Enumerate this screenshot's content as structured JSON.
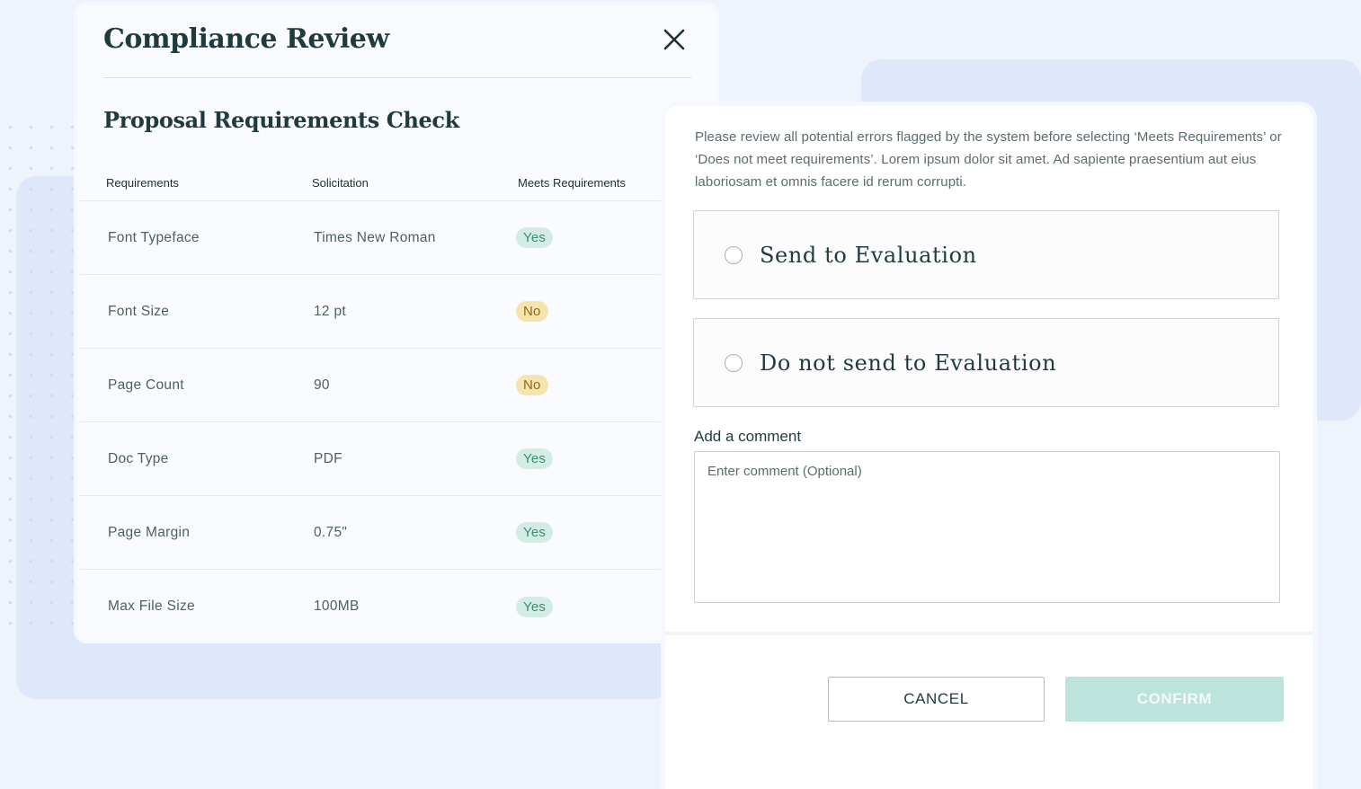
{
  "compliance": {
    "title": "Compliance Review",
    "subtitle": "Proposal Requirements Check",
    "headers": [
      "Requirements",
      "Solicitation",
      "Meets Requirements"
    ],
    "rows": [
      {
        "requirement": "Font Typeface",
        "solicitation": "Times New Roman",
        "meets": "Yes"
      },
      {
        "requirement": "Font Size",
        "solicitation": "12 pt",
        "meets": "No"
      },
      {
        "requirement": "Page Count",
        "solicitation": "90",
        "meets": "No"
      },
      {
        "requirement": "Doc Type",
        "solicitation": "PDF",
        "meets": "Yes"
      },
      {
        "requirement": "Page Margin",
        "solicitation": "0.75\"",
        "meets": "Yes"
      },
      {
        "requirement": "Max File Size",
        "solicitation": "100MB",
        "meets": "Yes"
      }
    ]
  },
  "decision": {
    "instructions": "Please review all potential errors flagged by the system before selecting ‘Meets Requirements’ or ‘Does not meet requirements’. Lorem ipsum dolor sit amet. Ad sapiente praesentium aut eius laboriosam et omnis facere id rerum corrupti.",
    "options": [
      {
        "label": "Send to Evaluation"
      },
      {
        "label": "Do not send to Evaluation"
      }
    ],
    "comment_label": "Add a comment",
    "comment_placeholder": "Enter comment (Optional)",
    "cancel_label": "CANCEL",
    "confirm_label": "CONFIRM"
  },
  "colors": {
    "yes_badge": "#d3ede5",
    "no_badge": "#f6e4ac",
    "confirm_disabled": "#bce4dc",
    "heading": "#1f3b3e"
  },
  "icons": {
    "close": "close-icon"
  }
}
